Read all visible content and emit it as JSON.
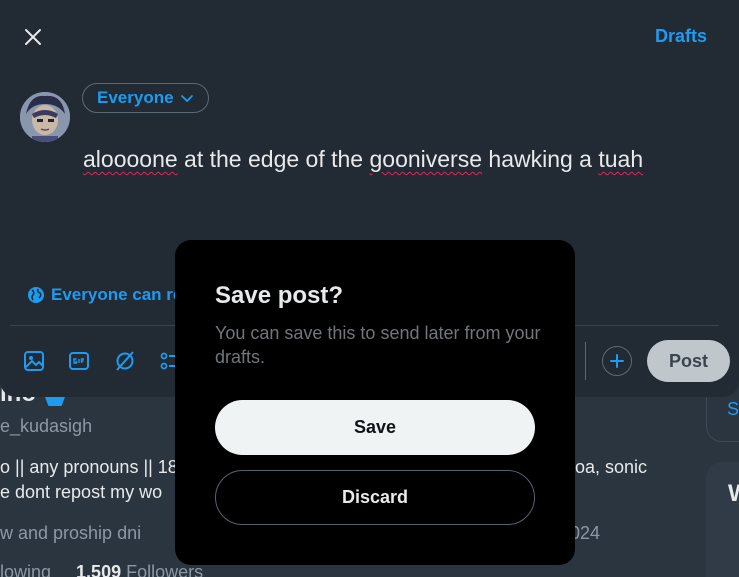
{
  "colors": {
    "accent": "#1d9bf0",
    "modal_bg": "#000000",
    "composer_bg": "#222a33"
  },
  "background": {
    "name": "ino",
    "handle": "e_kudasigh",
    "bio_line1_left": "o || any pronouns || 18",
    "bio_line1_right": "oa, sonic",
    "bio_line2": "e dont repost my wo",
    "meta_left": "w and proship dni",
    "meta_right": "024",
    "following_label": "lowing",
    "followers_count": "1,509",
    "followers_label": "Followers",
    "side_link_partial": "S",
    "side_heading_partial": "W"
  },
  "composer": {
    "close_icon": "close-icon",
    "drafts_label": "Drafts",
    "audience_label": "Everyone",
    "text_words": [
      "aloooone",
      " at the edge of the ",
      "gooniverse",
      " hawking a ",
      "tuah"
    ],
    "reply_setting_label": "Everyone can re",
    "tools": [
      "image-icon",
      "gif-icon",
      "grok-icon",
      "poll-icon"
    ],
    "add_icon": "plus-icon",
    "post_label": "Post"
  },
  "modal": {
    "title": "Save post?",
    "body": "You can save this to send later from your drafts.",
    "save_label": "Save",
    "discard_label": "Discard"
  }
}
